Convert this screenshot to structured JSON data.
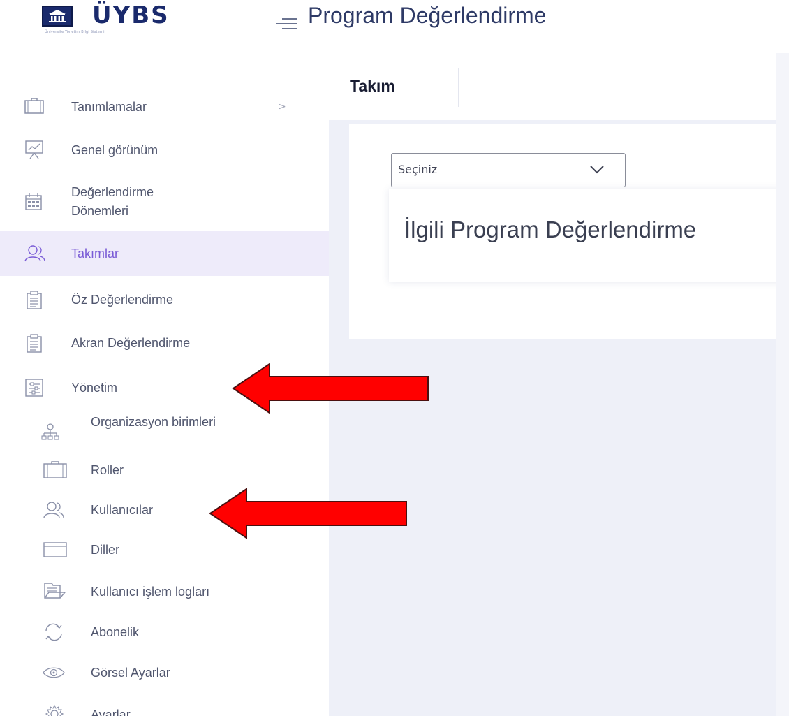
{
  "header": {
    "logo_text": "ÜYBS",
    "logo_subtitle": "Üniversite Yönetim Bilgi Sistemi",
    "app_title": "Program Değerlendirme"
  },
  "sidebar": {
    "items": [
      {
        "label": "Tanımlamalar",
        "icon": "briefcase-icon",
        "has_arrow": true,
        "arrow": ">"
      },
      {
        "label": "Genel görünüm",
        "icon": "presentation-chart-icon"
      },
      {
        "label": "Değerlendirme Dönemleri",
        "icon": "calendar-icon"
      },
      {
        "label": "Takımlar",
        "icon": "users-icon",
        "active": true
      },
      {
        "label": "Öz Değerlendirme",
        "icon": "clipboard-icon"
      },
      {
        "label": "Akran Değerlendirme",
        "icon": "clipboard-icon"
      },
      {
        "label": "Yönetim",
        "icon": "settings-panel-icon"
      }
    ],
    "subitems": [
      {
        "label": "Organizasyon birimleri",
        "icon": "org-chart-icon"
      },
      {
        "label": "Roller",
        "icon": "briefcase-icon"
      },
      {
        "label": "Kullanıcılar",
        "icon": "users-icon"
      },
      {
        "label": "Diller",
        "icon": "window-icon"
      },
      {
        "label": "Kullanıcı işlem logları",
        "icon": "folder-icon"
      },
      {
        "label": "Abonelik",
        "icon": "refresh-icon"
      },
      {
        "label": "Görsel Ayarlar",
        "icon": "eye-icon"
      },
      {
        "label": "Ayarlar",
        "icon": "gear-icon"
      }
    ]
  },
  "main": {
    "subheader_title": "Takım",
    "select": {
      "value": "Seçiniz"
    },
    "card_title": "İlgili Program Değerlendirme"
  },
  "colors": {
    "brand": "#1a2a6c",
    "active_bg": "#eeebfa",
    "active_text": "#7a5cd6",
    "content_bg": "#eef0f8",
    "annotation_arrow": "#ff0000"
  }
}
